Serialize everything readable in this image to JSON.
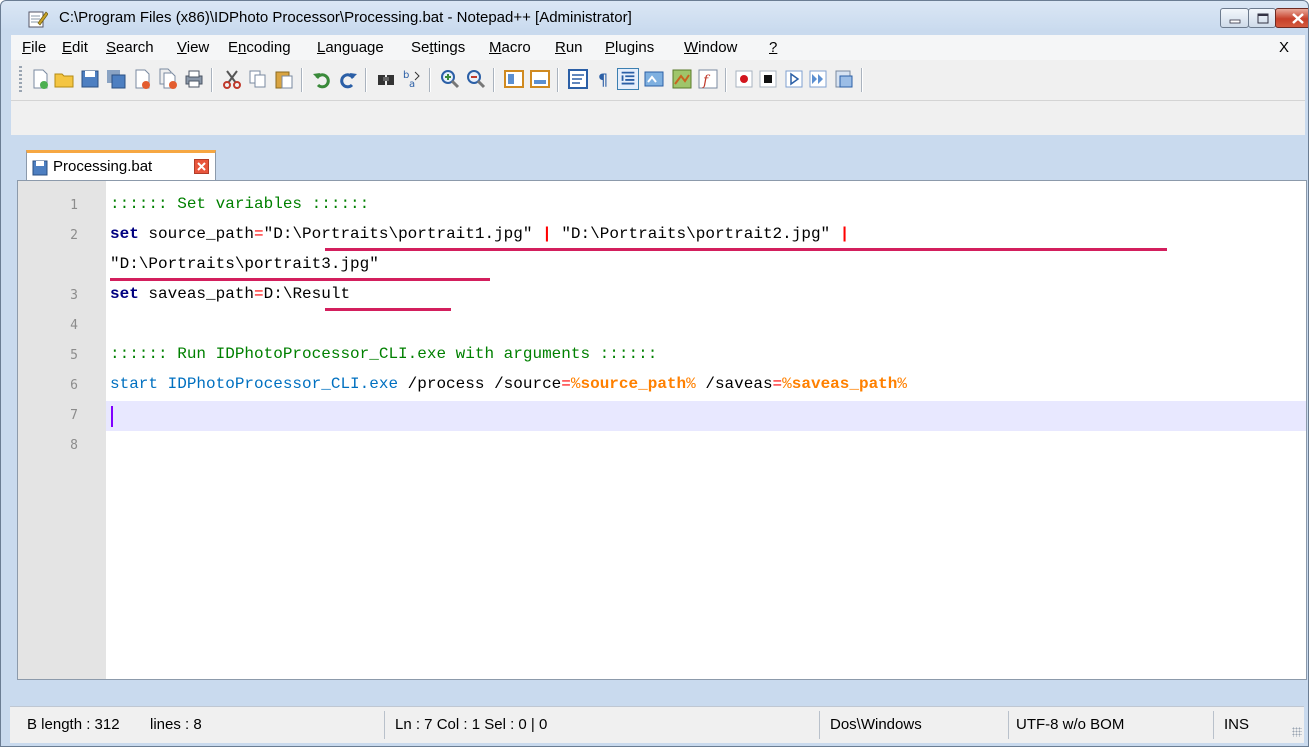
{
  "window": {
    "title": "C:\\Program Files (x86)\\IDPhoto Processor\\Processing.bat - Notepad++ [Administrator]"
  },
  "menu": {
    "items": [
      {
        "label": "File",
        "key": "F",
        "rest": "ile"
      },
      {
        "label": "Edit",
        "key": "E",
        "rest": "dit"
      },
      {
        "label": "Search",
        "key": "S",
        "rest": "earch"
      },
      {
        "label": "View",
        "key": "V",
        "rest": "iew"
      },
      {
        "label": "Encoding",
        "key": "n",
        "pre": "E",
        "rest": "coding"
      },
      {
        "label": "Language",
        "key": "L",
        "rest": "anguage"
      },
      {
        "label": "Settings",
        "key": "t",
        "pre": "Se",
        "rest": "tings"
      },
      {
        "label": "Macro",
        "key": "M",
        "rest": "acro"
      },
      {
        "label": "Run",
        "key": "R",
        "rest": "un"
      },
      {
        "label": "Plugins",
        "key": "P",
        "rest": "lugins"
      },
      {
        "label": "Window",
        "key": "W",
        "rest": "indow"
      },
      {
        "label": "?",
        "key": "?",
        "rest": ""
      }
    ],
    "close_label": "X"
  },
  "toolbar": {
    "icons": [
      "new-file-icon",
      "open-file-icon",
      "save-icon",
      "save-all-icon",
      "close-icon",
      "close-all-icon",
      "print-icon",
      "cut-icon",
      "copy-icon",
      "paste-icon",
      "undo-icon",
      "redo-icon",
      "find-icon",
      "replace-icon",
      "zoom-in-icon",
      "zoom-out-icon",
      "sync-vertical-icon",
      "sync-horizontal-icon",
      "word-wrap-icon",
      "show-all-chars-icon",
      "indent-guide-icon",
      "user-defined-language-icon",
      "document-map-icon",
      "function-list-icon",
      "record-macro-icon",
      "stop-record-icon",
      "playback-macro-icon",
      "run-macro-multiple-icon",
      "save-macro-icon"
    ]
  },
  "tab": {
    "label": "Processing.bat"
  },
  "editor": {
    "line_numbers": [
      "1",
      "2",
      "",
      "3",
      "4",
      "5",
      "6",
      "7",
      "8"
    ],
    "lines": {
      "l1": ":::::: Set variables ::::::",
      "l2_kw": "set",
      "l2_name": " source_path",
      "l2_eq": "=",
      "l2_v1": "\"D:\\Portraits\\portrait1.jpg\"",
      "l2_sp1": " ",
      "l2_pipe1": "|",
      "l2_sp2": " ",
      "l2_v2": "\"D:\\Portraits\\portrait2.jpg\"",
      "l2_sp3": " ",
      "l2_pipe2": "|",
      "l2b_v3": "\"D:\\Portraits\\portrait3.jpg\"",
      "l3_kw": "set",
      "l3_name": " saveas_path",
      "l3_eq": "=",
      "l3_val": "D:\\Result",
      "l5": ":::::: Run IDPhotoProcessor_CLI.exe with arguments ::::::",
      "l6_start": "start IDPhotoProcessor_CLI.exe",
      "l6_a1": " /process /source",
      "l6_eq1": "=",
      "l6_p1a": "%",
      "l6_v1": "source_path",
      "l6_p1b": "%",
      "l6_a2": " /saveas",
      "l6_eq2": "=",
      "l6_p2a": "%",
      "l6_v2": "saveas_path",
      "l6_p2b": "%"
    }
  },
  "status": {
    "length": "B length : 312",
    "lines": "lines : 8",
    "position": "Ln : 7   Col : 1   Sel : 0 | 0",
    "eol": "Dos\\Windows",
    "encoding": "UTF-8 w/o BOM",
    "mode": "INS"
  },
  "colors": {
    "comment": "#008000",
    "keyword": "#000080",
    "command": "#0070c0",
    "variable": "#ff8000",
    "operator": "#ff0000",
    "underline_annotation": "#d31f5d",
    "current_line": "#e8e8ff"
  }
}
